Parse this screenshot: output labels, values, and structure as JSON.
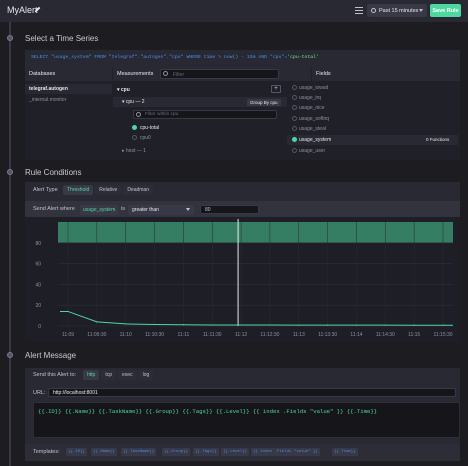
{
  "header": {
    "title": "MyAlert",
    "time_range": "Past 15 minutes",
    "save_label": "Save Rule"
  },
  "time_series": {
    "section_title": "Select a Time Series",
    "query_select": "SELECT \"usage_system\" FROM \"telegraf\".\"autogen\".\"cpu\" WHERE time > now() - 15m AND \"cpu\"=",
    "query_tag": "'cpu-total'",
    "databases_label": "Databases",
    "measurements_label": "Measurements",
    "fields_label": "Fields",
    "filter_placeholder": "Filter",
    "databases": [
      "telegraf.autogen",
      "_internal.monitor"
    ],
    "measurement": "cpu",
    "tag_key": "cpu — 2",
    "group_by": "Group By cpu",
    "filter_within_placeholder": "Filter within cpu",
    "tag_values": [
      "cpu-total",
      "cpu0"
    ],
    "host_row": "host — 1",
    "fields": [
      "usage_iowait",
      "usage_irq",
      "usage_nice",
      "usage_softirq",
      "usage_steal",
      "usage_system",
      "usage_user"
    ],
    "functions_label": "0 Functions"
  },
  "rule": {
    "section_title": "Rule Conditions",
    "alert_type_label": "Alert Type",
    "alert_types": [
      "Threshold",
      "Relative",
      "Deadman"
    ],
    "send_where_label": "Send Alert where",
    "field_badge": "usage_system",
    "is_label": "is",
    "operator": "greater than",
    "threshold_value": "80"
  },
  "chart_data": {
    "type": "line",
    "x": [
      "11:09",
      "11:09:30",
      "11:10",
      "11:10:30",
      "11:11",
      "11:11:30",
      "11:12",
      "11:12:30",
      "11:13",
      "11:13:30",
      "11:14",
      "11:14:30",
      "11:15",
      "11:15:30"
    ],
    "series": [
      {
        "values": [
          14,
          4,
          2,
          1.5,
          1.2,
          1,
          1,
          1,
          0.8,
          0.8,
          0.8,
          0.8,
          0.7,
          0.7
        ]
      }
    ],
    "yticks": [
      "0",
      "20",
      "40",
      "60",
      "80"
    ],
    "ylim": [
      0,
      100
    ],
    "threshold_band": [
      80,
      100
    ],
    "series_color": "#4ed8a0",
    "band_color": "#3b8f6e"
  },
  "alert_message": {
    "section_title": "Alert Message",
    "send_to_label": "Send this Alert to:",
    "endpoints": [
      "http",
      "tcp",
      "exec",
      "log"
    ],
    "url_label": "URL:",
    "url_value": "http://localhost:8001",
    "message": "{{.ID}} {{.Name}}  {{.TaskName}} {{.Group}} {{.Tags}} {{.Level}} {{ index .Fields \"value\" }} {{.Time}}",
    "templates_label": "Templates:",
    "templates": [
      "{{.ID}}",
      "{{.Name}}",
      "{{.TaskName}}",
      "{{.Group}}",
      "{{.Tags}}",
      "{{.Level}}",
      "{{ index .Fields \"value\" }}",
      "{{.Time}}"
    ]
  }
}
